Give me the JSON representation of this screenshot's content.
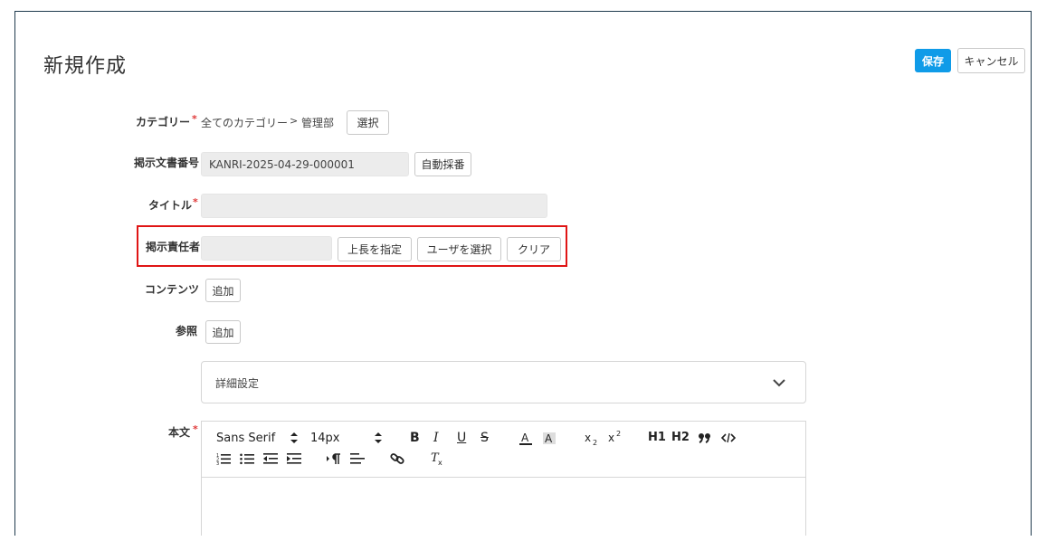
{
  "page": {
    "title": "新規作成"
  },
  "header_actions": {
    "save_label": "保存",
    "cancel_label": "キャンセル"
  },
  "form": {
    "category": {
      "label": "カテゴリー",
      "required_mark": "*",
      "root": "全てのカテゴリー",
      "separator": ">",
      "value": "管理部",
      "select_label": "選択"
    },
    "doc_number": {
      "label": "掲示文書番号",
      "value": "KANRI-2025-04-29-000001",
      "auto_label": "自動採番"
    },
    "title": {
      "label": "タイトル",
      "required_mark": "*",
      "value": ""
    },
    "responsible": {
      "label": "掲示責任者",
      "value": "",
      "superior_label": "上長を指定",
      "select_user_label": "ユーザを選択",
      "clear_label": "クリア"
    },
    "contents": {
      "label": "コンテンツ",
      "add_label": "追加"
    },
    "reference": {
      "label": "参照",
      "add_label": "追加"
    },
    "advanced": {
      "label": "詳細設定"
    },
    "body": {
      "label": "本文",
      "required_mark": "*",
      "toolbar": {
        "font_family": "Sans Serif",
        "font_size": "14px",
        "bold": "B",
        "italic": "I",
        "underline": "U",
        "strike": "S",
        "heading1": "H1",
        "heading2": "H2"
      }
    }
  },
  "colors": {
    "primary": "#0f9be8",
    "required": "#e03a3a",
    "highlight": "#e01515"
  }
}
